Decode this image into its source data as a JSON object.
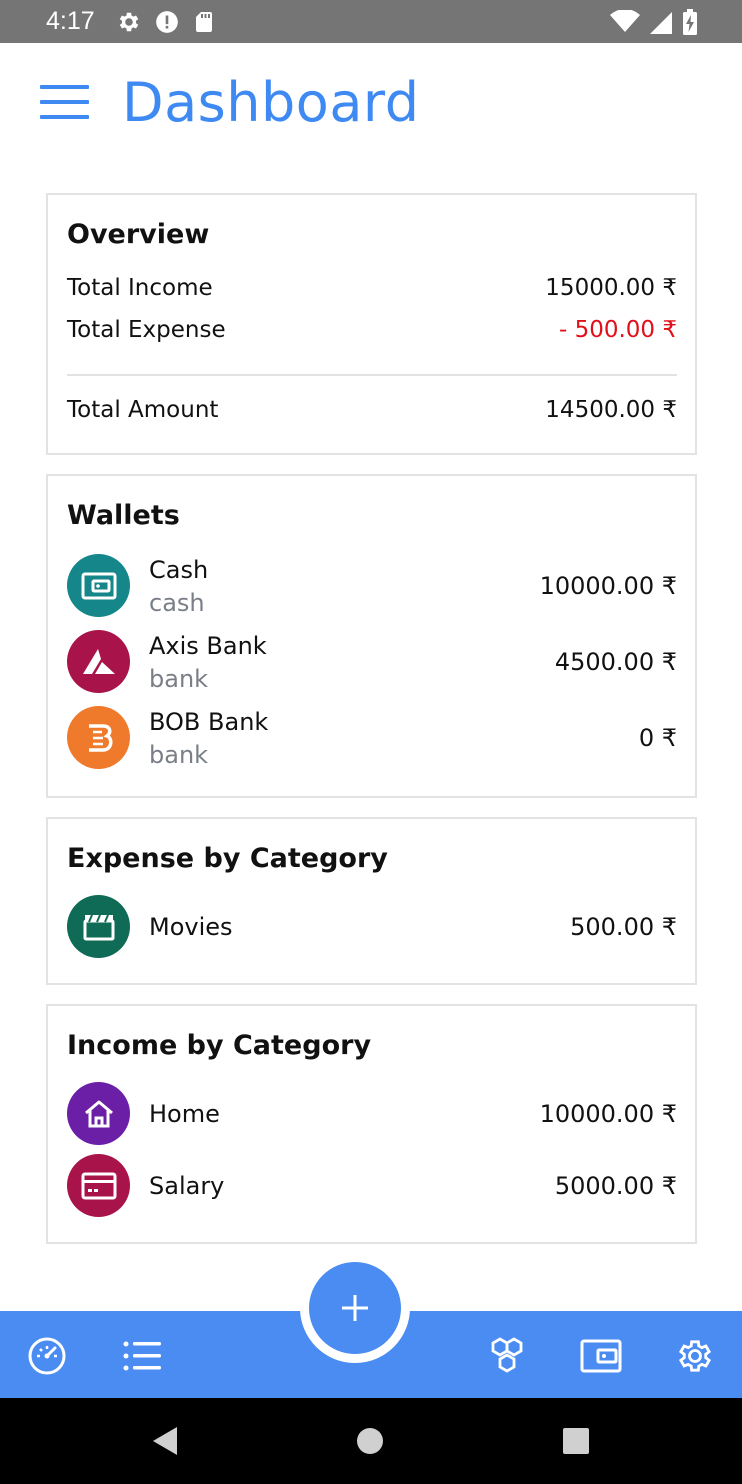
{
  "status_bar": {
    "time": "4:17",
    "icons_left": [
      "settings-icon",
      "alert-icon",
      "sd-card-icon"
    ],
    "icons_right": [
      "wifi-icon",
      "signal-icon",
      "battery-icon"
    ]
  },
  "app_bar": {
    "title": "Dashboard",
    "menu_icon": "hamburger-menu-icon",
    "title_color": "#3f8af2"
  },
  "overview": {
    "title": "Overview",
    "rows": [
      {
        "label": "Total Income",
        "value": "15000.00 ₹"
      },
      {
        "label": "Total Expense",
        "value": "- 500.00 ₹"
      }
    ],
    "total": {
      "label": "Total Amount",
      "value": "14500.00 ₹"
    },
    "expense_color": "#e0101a"
  },
  "wallets": {
    "title": "Wallets",
    "items": [
      {
        "name": "Cash",
        "type": "cash",
        "amount": "10000.00 ₹",
        "icon": "wallet-icon",
        "color": "#15868a"
      },
      {
        "name": "Axis Bank",
        "type": "bank",
        "amount": "4500.00 ₹",
        "icon": "axis-bank-logo-icon",
        "color": "#a8144a"
      },
      {
        "name": "BOB Bank",
        "type": "bank",
        "amount": "0 ₹",
        "icon": "bob-bank-logo-icon",
        "color": "#f07a2c"
      }
    ]
  },
  "expense_by_category": {
    "title": "Expense by Category",
    "items": [
      {
        "name": "Movies",
        "amount": "500.00 ₹",
        "icon": "clapperboard-icon",
        "color": "#0f6b56"
      }
    ]
  },
  "income_by_category": {
    "title": "Income by Category",
    "items": [
      {
        "name": "Home",
        "amount": "10000.00 ₹",
        "icon": "home-icon",
        "color": "#6a1fa6"
      },
      {
        "name": "Salary",
        "amount": "5000.00 ₹",
        "icon": "credit-card-icon",
        "color": "#a8144a"
      }
    ]
  },
  "bottom_nav": {
    "color": "#4a8cf2",
    "items": [
      "dashboard-icon",
      "list-icon",
      "add-icon",
      "categories-icon",
      "wallet-icon",
      "settings-icon"
    ]
  },
  "system_nav": {
    "items": [
      "back-icon",
      "home-icon",
      "recents-icon"
    ]
  }
}
